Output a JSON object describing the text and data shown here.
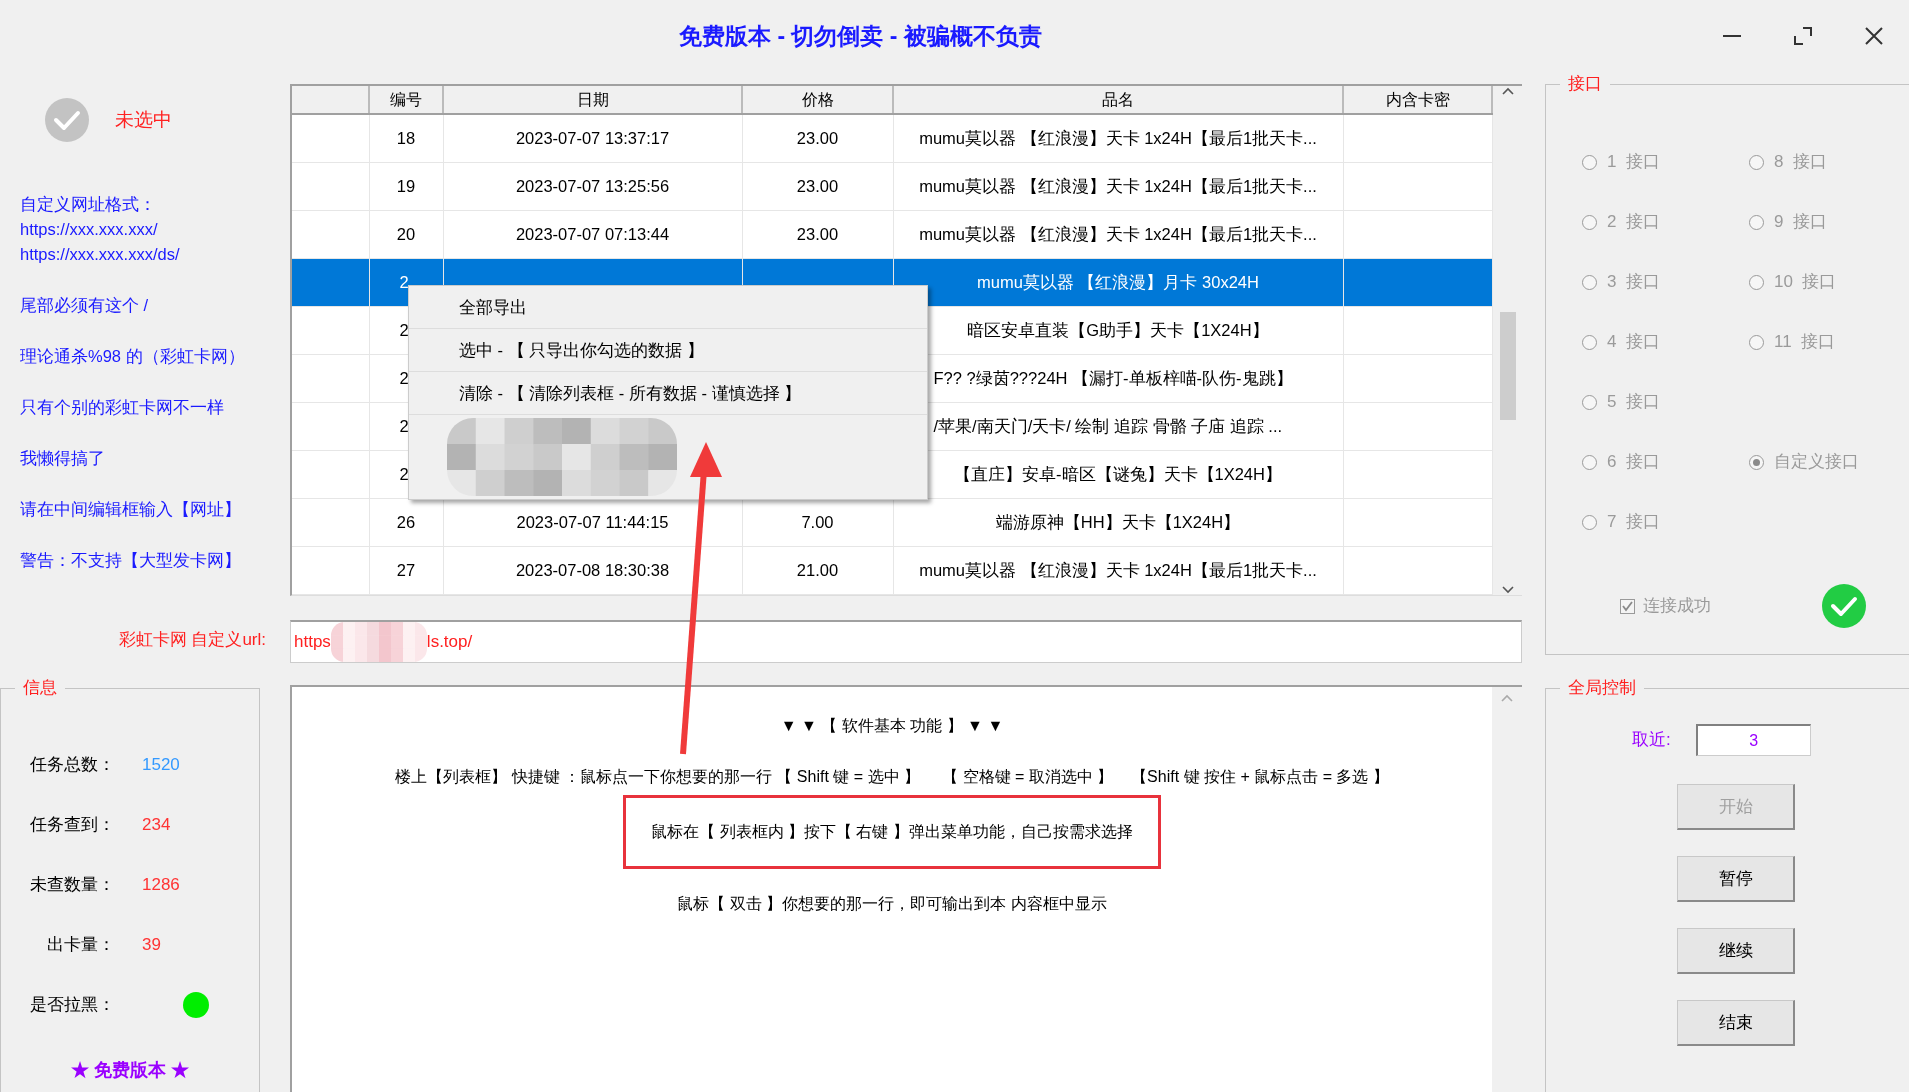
{
  "window": {
    "title": "免费版本 - 切勿倒卖 - 被骗概不负责"
  },
  "selection_status": {
    "label": "未选中",
    "selected": false
  },
  "notes": [
    [
      "自定义网址格式：",
      "https://xxx.xxx.xxx/",
      "https://xxx.xxx.xxx/ds/"
    ],
    [
      "尾部必须有这个 /"
    ],
    [
      "理论通杀%98 的（彩虹卡网）"
    ],
    [
      "只有个别的彩虹卡网不一样"
    ],
    [
      "我懒得搞了"
    ],
    [
      "请在中间编辑框输入【网址】"
    ],
    [
      "警告：不支持【大型发卡网】"
    ]
  ],
  "table": {
    "columns": [
      "编号",
      "日期",
      "价格",
      "品名",
      "内含卡密"
    ],
    "rows": [
      {
        "id": "18",
        "date": "2023-07-07 13:37:17",
        "price": "23.00",
        "name": "mumu莫以器 【红浪漫】天卡 1x24H【最后1批天卡...",
        "selected": false,
        "covered": false,
        "clipped": false
      },
      {
        "id": "19",
        "date": "2023-07-07 13:25:56",
        "price": "23.00",
        "name": "mumu莫以器 【红浪漫】天卡 1x24H【最后1批天卡...",
        "selected": false,
        "covered": false,
        "clipped": false
      },
      {
        "id": "20",
        "date": "2023-07-07 07:13:44",
        "price": "23.00",
        "name": "mumu莫以器 【红浪漫】天卡 1x24H【最后1批天卡...",
        "selected": false,
        "covered": false,
        "clipped": false
      },
      {
        "id": "2",
        "name": "mumu莫以器 【红浪漫】月卡 30x24H",
        "selected": true,
        "covered": true,
        "clipped": false
      },
      {
        "id": "2",
        "name": "暗区安卓直装【G助手】天卡【1X24H】",
        "selected": false,
        "covered": true,
        "clipped": false
      },
      {
        "id": "2",
        "name": "F?? ?绿茵???24H 【漏打-单板梓喵-队伤-鬼跳】",
        "selected": false,
        "covered": true,
        "clipped": true
      },
      {
        "id": "2",
        "name": "/苹果/南天门/天卡/ 绘制 追踪 骨骼 子庙 追踪 ...",
        "selected": false,
        "covered": true,
        "clipped": true
      },
      {
        "id": "2",
        "name": "【直庄】安卓-暗区【谜兔】天卡【1X24H】",
        "selected": false,
        "covered": true,
        "clipped": false
      },
      {
        "id": "26",
        "date": "2023-07-07 11:44:15",
        "price": "7.00",
        "name": "端游原神【HH】天卡【1X24H】",
        "selected": false,
        "covered": false,
        "clipped": false
      },
      {
        "id": "27",
        "date": "2023-07-08 18:30:38",
        "price": "21.00",
        "name": "mumu莫以器 【红浪漫】天卡 1x24H【最后1批天卡...",
        "selected": false,
        "covered": false,
        "clipped": false
      }
    ]
  },
  "context_menu": {
    "items": [
      {
        "kind": "text",
        "label": "全部导出"
      },
      {
        "kind": "text",
        "label": "选中 - 【 只导出你勾选的数据 】"
      },
      {
        "kind": "text",
        "label": "清除 - 【 清除列表框 - 所有数据 - 谨慎选择 】"
      },
      {
        "kind": "redacted"
      }
    ]
  },
  "annotation_arrow": true,
  "url": {
    "label": "彩虹卡网 自定义url:",
    "value_start": "https",
    "value_end": "ls.top/"
  },
  "info": {
    "title": "信息",
    "rows": [
      {
        "kind": "value",
        "label": "任务总数：",
        "value": "1520",
        "color": "#3399ff"
      },
      {
        "kind": "value",
        "label": "任务查到：",
        "value": "234",
        "color": "#ff3333"
      },
      {
        "kind": "value",
        "label": "未查数量：",
        "value": "1286",
        "color": "#ff3333"
      },
      {
        "kind": "value",
        "label": "出卡量：",
        "value": "39",
        "color": "#ff3333"
      },
      {
        "kind": "dot",
        "label": "是否拉黑：",
        "color": "#00ee00"
      }
    ],
    "footer": "★ 免费版本 ★"
  },
  "textbox": {
    "lines": [
      {
        "text": "▼ ▼ 【 软件基本 功能 】 ▼ ▼",
        "highlighted": false
      },
      {
        "text": "楼上【列表框】 快捷键 ：鼠标点一下你想要的那一行 【 Shift 键 = 选中 】     【 空格键 = 取消选中 】    【Shift 键 按住 + 鼠标点击 = 多选 】",
        "highlighted": false
      },
      {
        "text": "鼠标在【 列表框内 】按下【 右键 】弹出菜单功能，自己按需求选择",
        "highlighted": true
      },
      {
        "text": "鼠标【 双击 】你想要的那一行，即可输出到本 内容框中显示",
        "highlighted": false
      }
    ]
  },
  "interfaces": {
    "title": "接口",
    "rows": [
      [
        {
          "label": "1  接口",
          "selected": false,
          "disabled": true
        },
        {
          "label": "8  接口",
          "selected": false,
          "disabled": true
        }
      ],
      [
        {
          "label": "2  接口",
          "selected": false,
          "disabled": true
        },
        {
          "label": "9  接口",
          "selected": false,
          "disabled": true
        }
      ],
      [
        {
          "label": "3  接口",
          "selected": false,
          "disabled": true
        },
        {
          "label": "10  接口",
          "selected": false,
          "disabled": true
        }
      ],
      [
        {
          "label": "4  接口",
          "selected": false,
          "disabled": true
        },
        {
          "label": "11  接口",
          "selected": false,
          "disabled": true
        }
      ],
      [
        {
          "label": "5  接口",
          "selected": false,
          "disabled": true
        }
      ],
      [
        {
          "label": "6  接口",
          "selected": false,
          "disabled": true
        },
        {
          "label": "自定义接口",
          "selected": true,
          "disabled": true
        }
      ],
      [
        {
          "label": "7  接口",
          "selected": false,
          "disabled": true
        }
      ]
    ],
    "connection": {
      "label": "连接成功",
      "checked": true,
      "disabled": true
    }
  },
  "control": {
    "title": "全局控制",
    "field": {
      "label": "取近:",
      "value": "3"
    },
    "buttons": [
      {
        "label": "开始",
        "disabled": true
      },
      {
        "label": "暂停",
        "disabled": false
      },
      {
        "label": "继续",
        "disabled": false
      },
      {
        "label": "结束",
        "disabled": false
      }
    ]
  }
}
